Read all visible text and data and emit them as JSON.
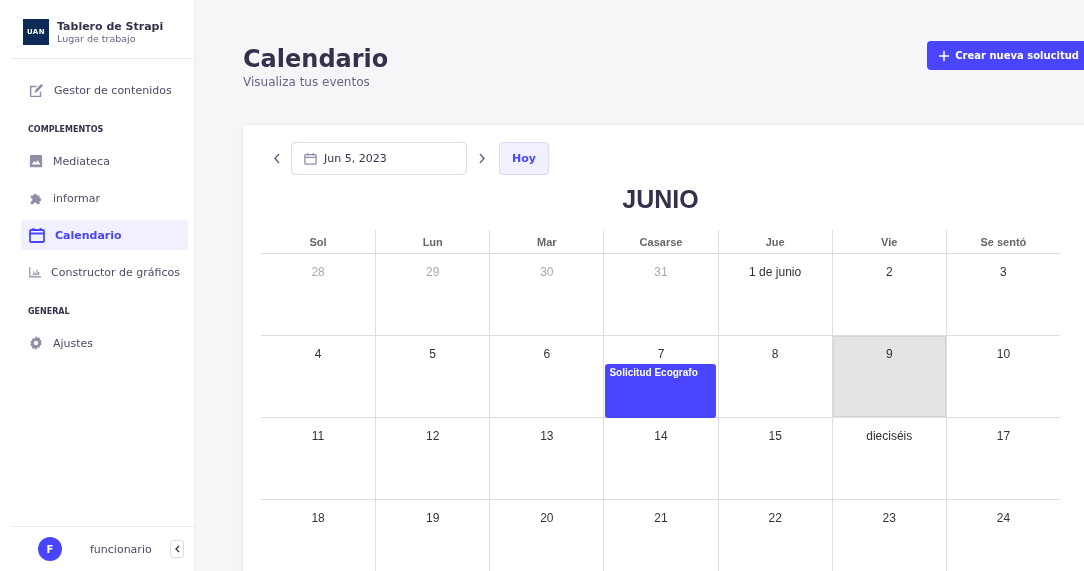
{
  "sidebar": {
    "logo_text": "UAN",
    "title": "Tablero de Strapi",
    "subtitle": "Lugar de trabajo",
    "sections": [
      {
        "items": [
          {
            "label": "Gestor de contenidos",
            "selected": false
          }
        ]
      },
      {
        "heading": "COMPLEMENTOS",
        "items": [
          {
            "label": "Mediateca",
            "selected": false
          },
          {
            "label": "informar",
            "selected": false
          },
          {
            "label": "Calendario",
            "selected": true
          },
          {
            "label": "Constructor de gráficos",
            "selected": false
          }
        ]
      },
      {
        "heading": "GENERAL",
        "items": [
          {
            "label": "Ajustes",
            "selected": false
          }
        ]
      }
    ],
    "user": {
      "initial": "F",
      "name": "funcionario"
    }
  },
  "header": {
    "title": "Calendario",
    "subtitle": "Visualiza tus eventos",
    "action": "Crear nueva solucitud"
  },
  "toolbar": {
    "date": "Jun 5, 2023",
    "today_button": "Hoy"
  },
  "calendar": {
    "month": "JUNIO",
    "weekdays": [
      "Sol",
      "Lun",
      "Mar",
      "Casarse",
      "Jue",
      "Vie",
      "Se sentó"
    ],
    "weeks": [
      [
        {
          "label": "28",
          "outside": true,
          "today": false
        },
        {
          "label": "29",
          "outside": true,
          "today": false
        },
        {
          "label": "30",
          "outside": true,
          "today": false
        },
        {
          "label": "31",
          "outside": true,
          "today": false
        },
        {
          "label": "1 de junio",
          "outside": false,
          "today": false
        },
        {
          "label": "2",
          "outside": false,
          "today": false
        },
        {
          "label": "3",
          "outside": false,
          "today": false
        }
      ],
      [
        {
          "label": "4",
          "outside": false,
          "today": false
        },
        {
          "label": "5",
          "outside": false,
          "today": false
        },
        {
          "label": "6",
          "outside": false,
          "today": false
        },
        {
          "label": "7",
          "outside": false,
          "today": false,
          "events": [
            "Solicitud Ecografo"
          ]
        },
        {
          "label": "8",
          "outside": false,
          "today": false
        },
        {
          "label": "9",
          "outside": false,
          "today": true
        },
        {
          "label": "10",
          "outside": false,
          "today": false
        }
      ],
      [
        {
          "label": "11",
          "outside": false,
          "today": false
        },
        {
          "label": "12",
          "outside": false,
          "today": false
        },
        {
          "label": "13",
          "outside": false,
          "today": false
        },
        {
          "label": "14",
          "outside": false,
          "today": false
        },
        {
          "label": "15",
          "outside": false,
          "today": false
        },
        {
          "label": "dieciséis",
          "outside": false,
          "today": false
        },
        {
          "label": "17",
          "outside": false,
          "today": false
        }
      ],
      [
        {
          "label": "18",
          "outside": false,
          "today": false
        },
        {
          "label": "19",
          "outside": false,
          "today": false
        },
        {
          "label": "20",
          "outside": false,
          "today": false
        },
        {
          "label": "21",
          "outside": false,
          "today": false
        },
        {
          "label": "22",
          "outside": false,
          "today": false
        },
        {
          "label": "23",
          "outside": false,
          "today": false
        },
        {
          "label": "24",
          "outside": false,
          "today": false
        }
      ]
    ]
  }
}
